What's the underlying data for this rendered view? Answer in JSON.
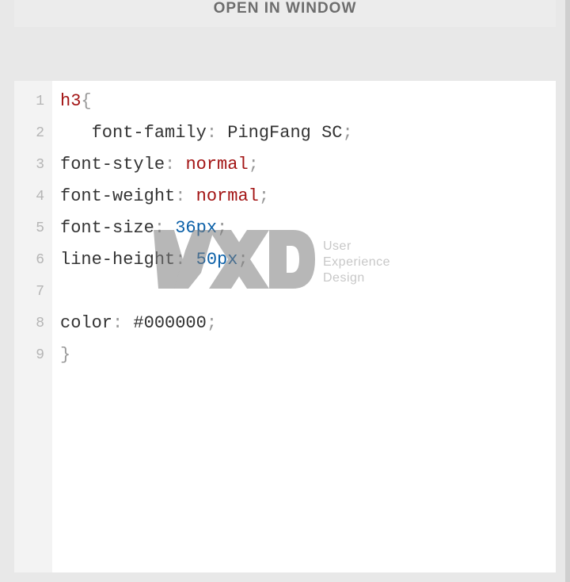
{
  "toolbar": {
    "open_label": "OPEN IN WINDOW"
  },
  "code": {
    "lines": [
      {
        "n": "1",
        "tokens": [
          {
            "t": "h3",
            "c": "sel"
          },
          {
            "t": "{",
            "c": "punct"
          }
        ]
      },
      {
        "n": "2",
        "tokens": [
          {
            "t": "   ",
            "c": ""
          },
          {
            "t": "font-family",
            "c": "property"
          },
          {
            "t": ": ",
            "c": "punct"
          },
          {
            "t": "PingFang SC",
            "c": "fam"
          },
          {
            "t": ";",
            "c": "punct"
          }
        ]
      },
      {
        "n": "3",
        "tokens": [
          {
            "t": "font-style",
            "c": "property"
          },
          {
            "t": ": ",
            "c": "punct"
          },
          {
            "t": "normal",
            "c": "value-normal"
          },
          {
            "t": ";",
            "c": "punct"
          }
        ]
      },
      {
        "n": "4",
        "tokens": [
          {
            "t": "font-weight",
            "c": "property"
          },
          {
            "t": ": ",
            "c": "punct"
          },
          {
            "t": "normal",
            "c": "value-normal"
          },
          {
            "t": ";",
            "c": "punct"
          }
        ]
      },
      {
        "n": "5",
        "tokens": [
          {
            "t": "font-size",
            "c": "property"
          },
          {
            "t": ": ",
            "c": "punct"
          },
          {
            "t": "36px",
            "c": "value-num"
          },
          {
            "t": ";",
            "c": "punct"
          }
        ]
      },
      {
        "n": "6",
        "tokens": [
          {
            "t": "line-height",
            "c": "property"
          },
          {
            "t": ": ",
            "c": "punct"
          },
          {
            "t": "50px",
            "c": "value-num"
          },
          {
            "t": ";",
            "c": "punct"
          }
        ]
      },
      {
        "n": "7",
        "tokens": []
      },
      {
        "n": "8",
        "tokens": [
          {
            "t": "color",
            "c": "property"
          },
          {
            "t": ": ",
            "c": "punct"
          },
          {
            "t": "#000000",
            "c": "value-hex"
          },
          {
            "t": ";",
            "c": "punct"
          }
        ]
      },
      {
        "n": "9",
        "tokens": [
          {
            "t": "}",
            "c": "punct"
          }
        ]
      }
    ]
  },
  "watermark": {
    "line1": "User",
    "line2": "Experience",
    "line3": "Design"
  }
}
